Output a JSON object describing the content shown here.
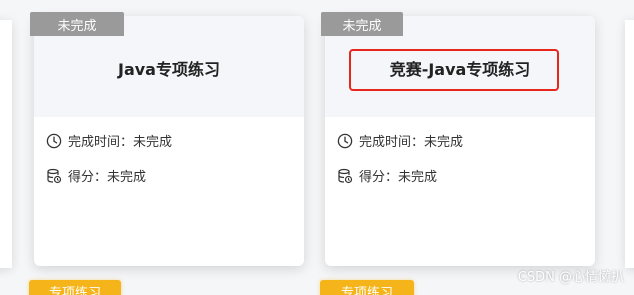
{
  "cards": [
    {
      "status": "未完成",
      "title": "Java专项练习",
      "time_label": "完成时间：",
      "time_value": "未完成",
      "score_label": "得分：",
      "score_value": "未完成"
    },
    {
      "status": "未完成",
      "title": "竞赛-Java专项练习",
      "time_label": "完成时间：",
      "time_value": "未完成",
      "score_label": "得分：",
      "score_value": "未完成"
    }
  ],
  "next_row_tags": [
    "专项练习",
    "专项练习"
  ],
  "watermark": "CSDN @心情懒扒",
  "icons": {
    "time": "clock-icon",
    "score": "database-icon"
  },
  "colors": {
    "status_tag": "#9a9a9a",
    "type_tag": "#f4b41a",
    "highlight": "#e8261c"
  }
}
